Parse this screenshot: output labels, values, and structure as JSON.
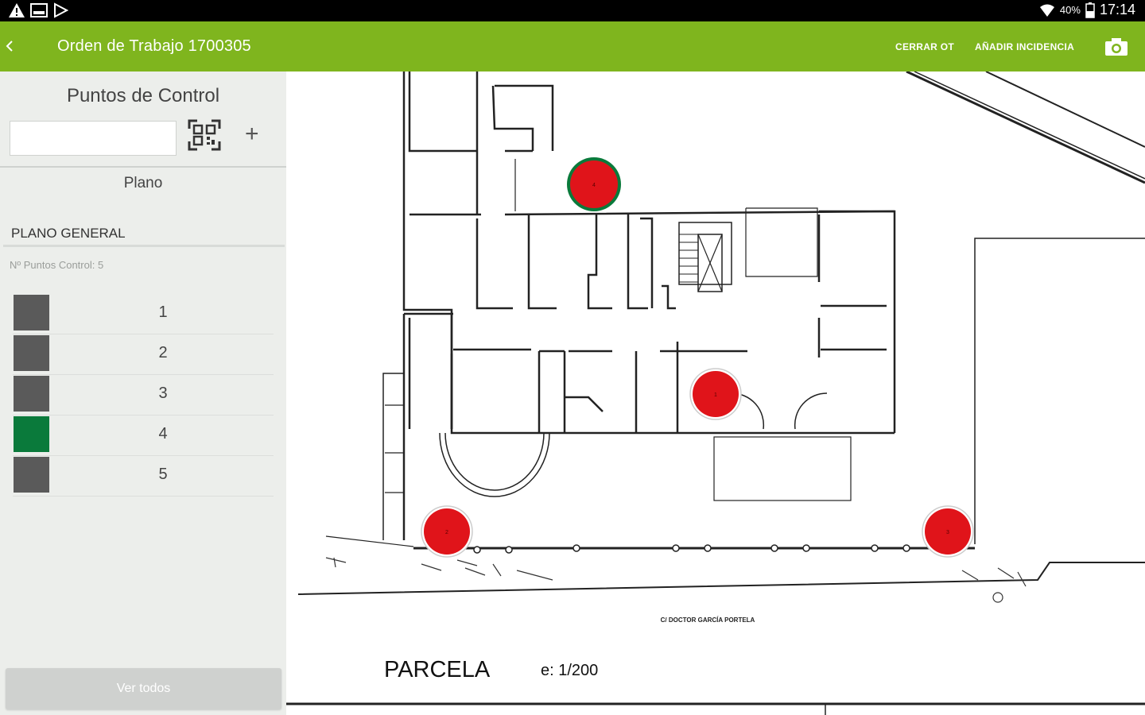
{
  "app": {
    "title": "Orden de Trabajo 1700305",
    "actions": {
      "close": "CERRAR OT",
      "add": "AÑADIR INCIDENCIA"
    },
    "accent": "#7fb51e"
  },
  "status_bar": {
    "battery": "40%",
    "time": "17:14"
  },
  "sidebar": {
    "title": "Puntos de Control",
    "search_value": "",
    "plano_label": "Plano",
    "plano_general": "PLANO GENERAL",
    "points_count": "Nº Puntos Control: 5",
    "points": [
      {
        "label": "1",
        "color": "#5a5a5a"
      },
      {
        "label": "2",
        "color": "#5a5a5a"
      },
      {
        "label": "3",
        "color": "#5a5a5a"
      },
      {
        "label": "4",
        "color": "#0a7a3b",
        "selected": true
      },
      {
        "label": "5",
        "color": "#5a5a5a"
      }
    ],
    "ver_todos": "Ver todos"
  },
  "plan": {
    "street": "C/ DOCTOR GARCÍA PORTELA",
    "parcela": "PARCELA",
    "scale": "e: 1/200",
    "markers": [
      {
        "label": "1",
        "color": "#e0141a"
      },
      {
        "label": "2",
        "color": "#e0141a"
      },
      {
        "label": "3",
        "color": "#e0141a"
      },
      {
        "label": "4",
        "color": "#e0141a",
        "ring": "#0a7a3b"
      }
    ]
  }
}
